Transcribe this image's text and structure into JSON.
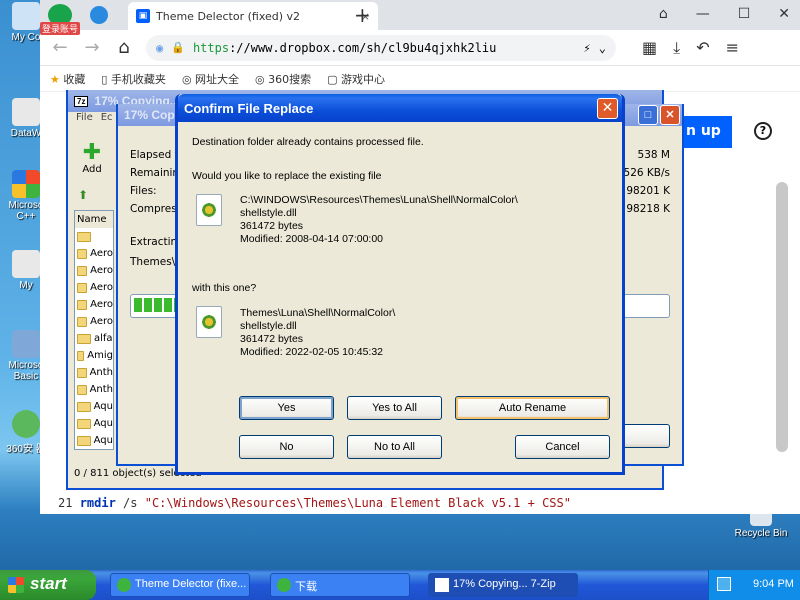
{
  "desktop": {
    "icons": [
      {
        "label": "My Co"
      },
      {
        "label": "DataW"
      },
      {
        "label": "Microso C++"
      },
      {
        "label": "My"
      },
      {
        "label": "Microso Basic"
      },
      {
        "label": "360安 器"
      }
    ],
    "recycle_bin": "Recycle Bin",
    "login_badge": "登录账号"
  },
  "browser": {
    "tab_title": "Theme Delector (fixed) v2",
    "url_scheme": "https",
    "url_rest": "://www.dropbox.com/sh/cl9bu4qjxhk2liu",
    "bookmarks": [
      "收藏",
      "手机收藏夹",
      "网址大全",
      "360搜索",
      "游戏中心"
    ],
    "signup_label": "n up",
    "help_label": "?",
    "code_last_line": {
      "num": "21",
      "cmd": "rmdir",
      "flag": " /s ",
      "arg": "\"C:\\Windows\\Resources\\Themes\\Luna Element Black v5.1 + CSS\""
    }
  },
  "sevenzip_back": {
    "title": "17% Copying...",
    "menu": [
      "File",
      "Ec"
    ],
    "toolbar_add": "Add",
    "column_name": "Name",
    "rows": [
      "",
      "Aero",
      "Aero",
      "Aero",
      "Aero",
      "Aero",
      "alfa",
      "Amig",
      "Anth",
      "Anth",
      "Aqu",
      "Aqu",
      "Aqu"
    ],
    "status": "0 / 811 object(s) selected",
    "line_numbers": [
      "1",
      "1",
      "1",
      "1",
      "1",
      "1",
      "1",
      "1",
      "1",
      "1",
      "1",
      "1"
    ]
  },
  "sevenzip_front": {
    "title": "17% Cop",
    "labels": [
      "Elapsed t",
      "Remainin",
      "Files:",
      "Compress"
    ],
    "values": [
      "538 M",
      "526 KB/s",
      "98201 K",
      "98218 K"
    ],
    "extracting": "Extracting",
    "path": "Themes\\",
    "progress_fraction": 0.17
  },
  "dialog": {
    "title": "Confirm File Replace",
    "line1": "Destination folder already contains processed file.",
    "line2": "Would you like to replace the existing file",
    "existing": {
      "path": "C:\\WINDOWS\\Resources\\Themes\\Luna\\Shell\\NormalColor\\",
      "name": "shellstyle.dll",
      "size": "361472 bytes",
      "modified": "Modified: 2008-04-14 07:00:00"
    },
    "with_this": "with this one?",
    "new_file": {
      "path": "Themes\\Luna\\Shell\\NormalColor\\",
      "name": "shellstyle.dll",
      "size": "361472 bytes",
      "modified": "Modified: 2022-02-05 10:45:32"
    },
    "buttons": {
      "yes": "Yes",
      "yes_all": "Yes to All",
      "auto_rename": "Auto Rename",
      "no": "No",
      "no_all": "No to All",
      "cancel": "Cancel"
    }
  },
  "taskbar": {
    "start": "start",
    "items": [
      "Theme Delector (fixe...",
      "下载",
      "17% Copying... 7-Zip"
    ],
    "clock": "9:04 PM"
  }
}
